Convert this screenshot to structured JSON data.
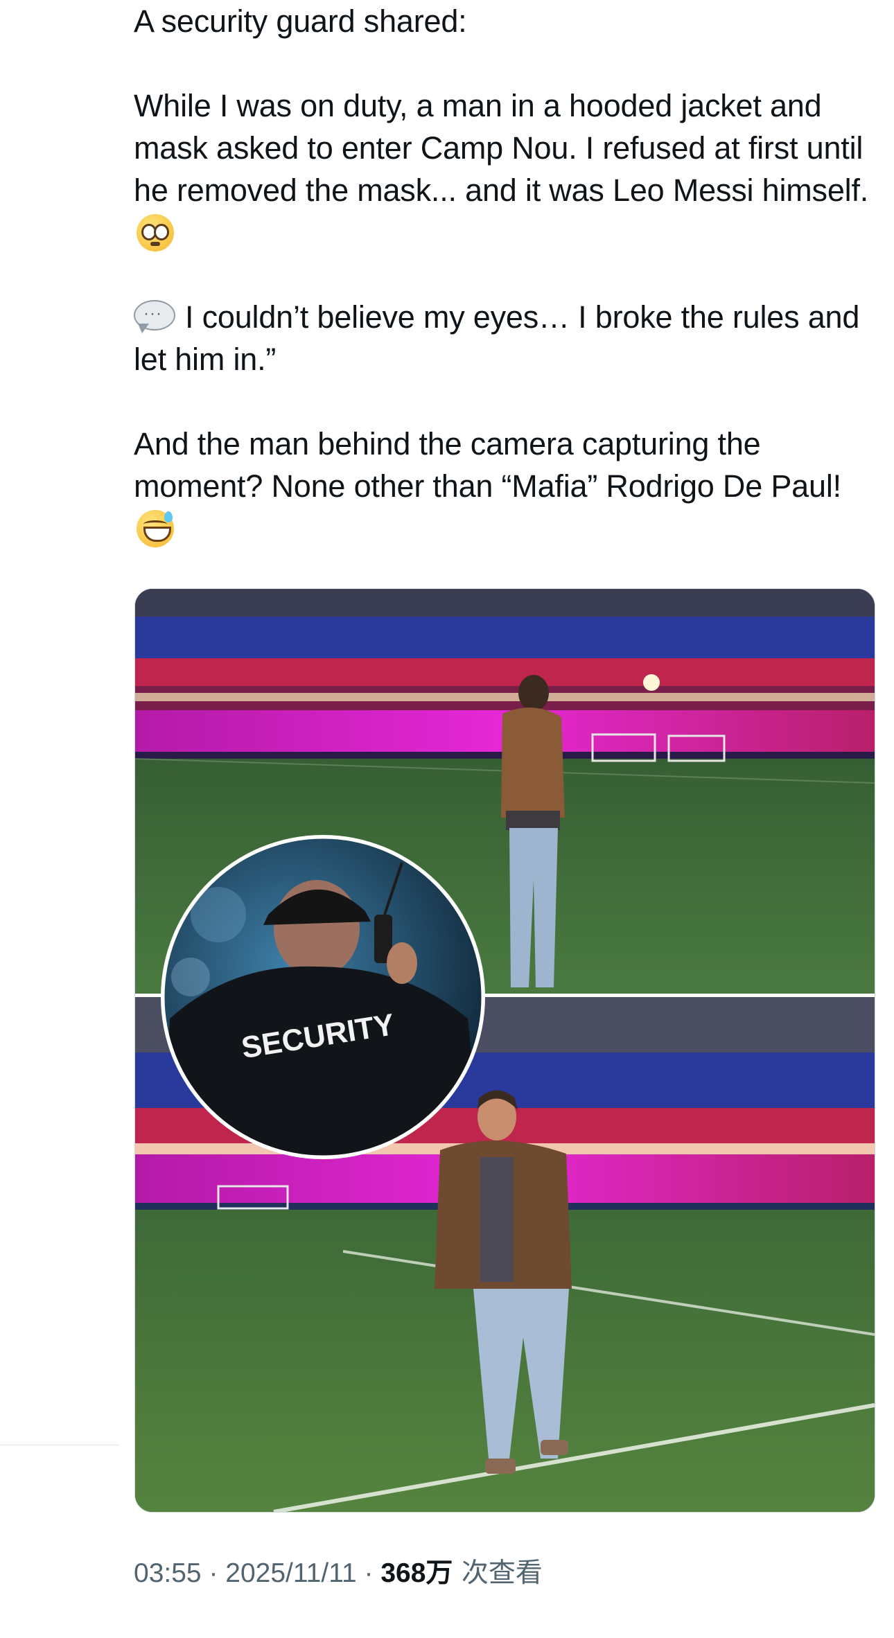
{
  "tweet": {
    "line_intro": "A security guard shared:",
    "paragraph1": "While I was on duty, a man in a hooded jacket and mask asked to enter Camp Nou. I refused at first until he removed the mask... and it was Leo Messi himself.",
    "paragraph2": "I couldn’t believe my eyes… I broke the rules and let him in.”",
    "paragraph3": "And the man behind the camera capturing the moment? None other than “Mafia” Rodrigo De Paul!",
    "emojis": [
      "flushed-face-emoji",
      "speech-balloon-emoji",
      "grinning-sweat-emoji"
    ]
  },
  "media": {
    "badge_text": "SECURITY",
    "colors": {
      "stands_magenta": "#d21fc4",
      "seats_blue": "#2a3a9c",
      "seats_red": "#c0264d",
      "pitch_green": "#3e6b37",
      "sky": "#0b1a2e"
    }
  },
  "meta": {
    "time": "03:55",
    "sep1": " · ",
    "date": "2025/11/11",
    "sep2": " · ",
    "views_count": "368万",
    "views_label": " 次查看"
  }
}
